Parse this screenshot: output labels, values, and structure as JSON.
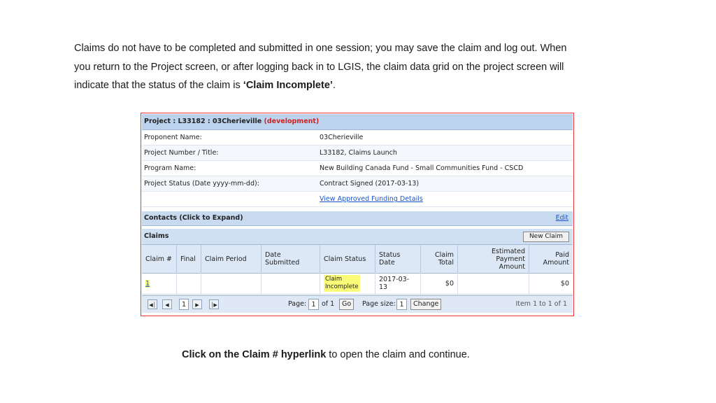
{
  "intro": {
    "line1": "Claims do not have to be completed and submitted in one session; you may save the claim and log out.  When",
    "line2": "you return to the Project screen, or after logging back in to LGIS, the claim data grid on the project screen will",
    "line3_pre": "indicate that the status of the claim is ",
    "line3_bold": "‘Claim Incomplete’",
    "line3_post": "."
  },
  "project": {
    "title": "Project : L33182 : 03Cherieville",
    "env": "(development)",
    "rows": [
      {
        "label": "Proponent Name:",
        "value": "03Cherieville"
      },
      {
        "label": "Project Number / Title:",
        "value": "L33182, Claims Launch"
      },
      {
        "label": "Program Name:",
        "value": "New Building Canada Fund - Small Communities Fund - CSCD"
      },
      {
        "label": "Project Status (Date yyyy-mm-dd):",
        "value": "Contract Signed (2017-03-13)"
      }
    ],
    "funding_link": "View Approved Funding Details"
  },
  "contacts": {
    "label": "Contacts (Click to Expand)",
    "edit": "Edit"
  },
  "claims": {
    "label": "Claims",
    "new_button": "New Claim",
    "columns": {
      "claim_no": "Claim #",
      "final": "Final",
      "period": "Claim Period",
      "submitted": "Date Submitted",
      "status": "Claim Status",
      "status_date": "Status Date",
      "total_1": "Claim",
      "total_2": "Total",
      "est_1": "Estimated Payment",
      "est_2": "Amount",
      "paid_1": "Paid",
      "paid_2": "Amount"
    },
    "row": {
      "claim_no": "1",
      "final": "",
      "period": "",
      "submitted": "",
      "status_1": "Claim",
      "status_2": "Incomplete",
      "status_date": "2017-03-13",
      "total": "$0",
      "est": "",
      "paid": "$0"
    },
    "highlight_color": "#fbfb7a"
  },
  "pager": {
    "current": "1",
    "page_label": "Page:",
    "page_value": "1",
    "of_label": "of 1",
    "go": "Go",
    "size_label": "Page size:",
    "size_value": "1",
    "change": "Change",
    "item_info": "Item 1 to 1 of 1"
  },
  "footer": {
    "bold": "Click on the Claim # hyperlink",
    "rest": " to open the claim and continue."
  },
  "colors": {
    "border": "#ee3333",
    "header": "#c8daf0",
    "link": "#1b55c9",
    "dev": "#d02020"
  }
}
